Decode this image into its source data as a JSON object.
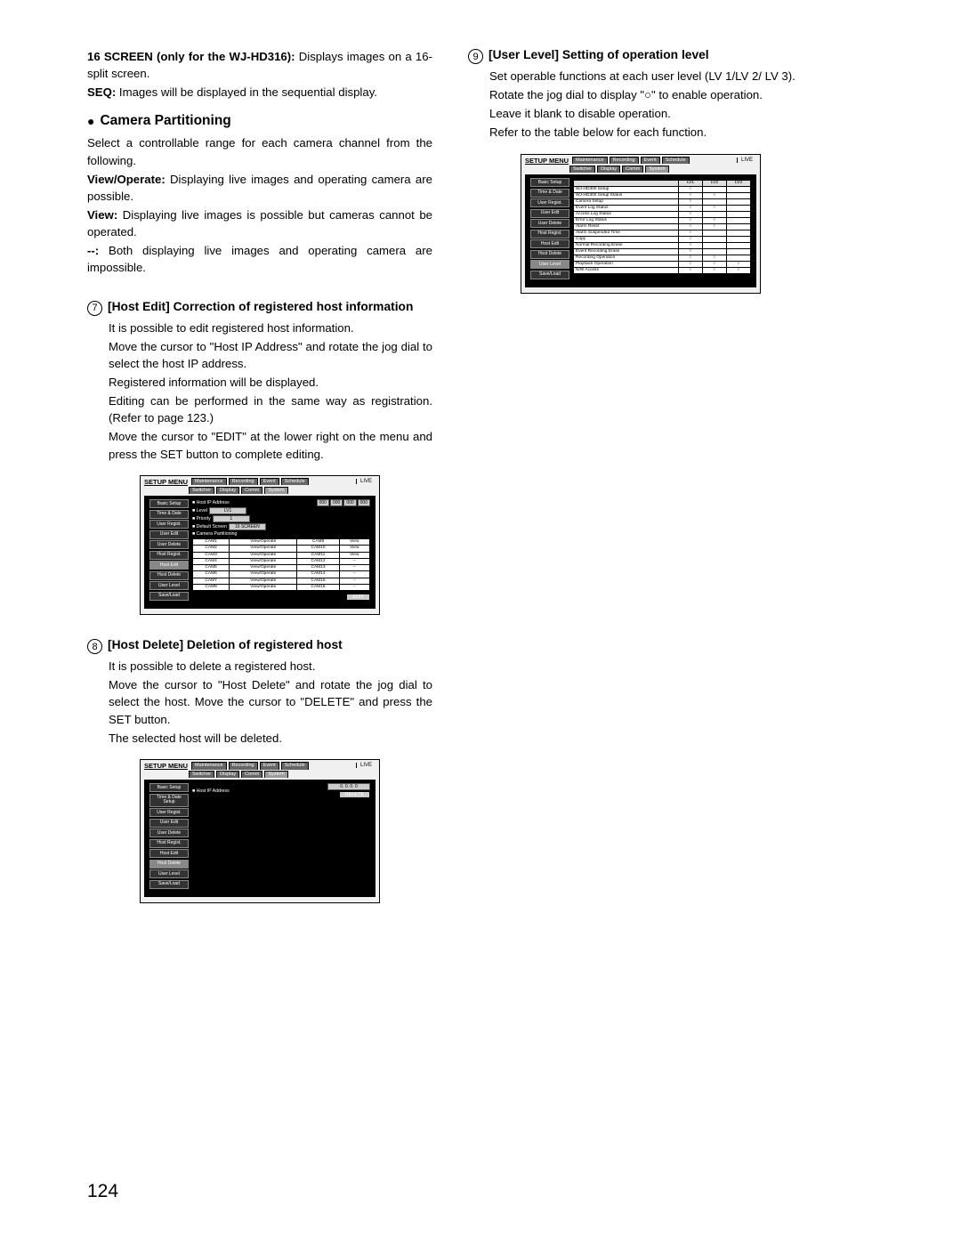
{
  "left": {
    "screen16": {
      "label": "16 SCREEN (only for the WJ-HD316):",
      "desc": "Displays images on a 16-split screen."
    },
    "seq": {
      "label": "SEQ:",
      "desc": "Images will be displayed in the sequential display."
    },
    "cam_part_title": "Camera Partitioning",
    "cam_part_intro": "Select a controllable range for each camera channel from the following.",
    "viewop": {
      "label": "View/Operate:",
      "desc": "Displaying live images and operating camera are possible."
    },
    "view": {
      "label": "View:",
      "desc": "Displaying live images is possible but cameras cannot be operated."
    },
    "dash": {
      "label": "--:",
      "desc": "Both displaying live images and operating camera are impossible."
    },
    "sec7": {
      "num": "7",
      "title": "[Host Edit] Correction of registered host information",
      "p1": "It is possible to edit registered host information.",
      "p2": "Move the cursor to \"Host IP Address\" and rotate the jog dial to select the host IP address.",
      "p3": "Registered information will be displayed.",
      "p4": "Editing can be performed in the same way as registration. (Refer to page 123.)",
      "p5": "Move the cursor to \"EDIT\" at the lower right on the menu and press the SET button to complete editing."
    },
    "fig7": {
      "title": "SETUP MENU",
      "tabs1": [
        "Maintenance",
        "Recording",
        "Event",
        "Schedule"
      ],
      "tabs2": [
        "Switcher",
        "Display",
        "Comm",
        "System"
      ],
      "live": "LIVE",
      "sidebar": [
        "Basic Setup",
        "Time & Date",
        "User Regist.",
        "User Edit",
        "User Delete",
        "Host Regist.",
        "Host Edit",
        "Host Delete",
        "User Level",
        "Save/Load"
      ],
      "sidebar_sel": "Host Edit",
      "fields": {
        "ip_label": "Host IP Address",
        "ip": [
          "000",
          "000",
          "000",
          "000"
        ],
        "level_label": "Level",
        "level": "LV1",
        "priority_label": "Priority",
        "priority": "1",
        "defscr_label": "Default Screen",
        "defscr": "16 SCREEN",
        "campart_label": "Camera Partitioning"
      },
      "cam_rows": [
        [
          "CAM1",
          "View/Operate",
          "CAM9",
          "View"
        ],
        [
          "CAM2",
          "View/Operate",
          "CAM10",
          "View"
        ],
        [
          "CAM3",
          "View/Operate",
          "CAM11",
          "View"
        ],
        [
          "CAM4",
          "View/Operate",
          "CAM12",
          "--"
        ],
        [
          "CAM5",
          "View/Operate",
          "CAM13",
          "--"
        ],
        [
          "CAM6",
          "View/Operate",
          "CAM14",
          "--"
        ],
        [
          "CAM7",
          "View/Operate",
          "CAM15",
          "--"
        ],
        [
          "CAM8",
          "View/Operate",
          "CAM16",
          "--"
        ]
      ],
      "edit": "EDIT"
    },
    "sec8": {
      "num": "8",
      "title": "[Host Delete] Deletion of registered host",
      "p1": "It is possible to delete a registered host.",
      "p2": "Move the cursor to \"Host Delete\" and rotate the jog dial to select the host. Move the cursor to \"DELETE\" and press the SET button.",
      "p3": "The selected host will be deleted."
    },
    "fig8": {
      "title": "SETUP MENU",
      "tabs1": [
        "Maintenance",
        "Recording",
        "Event",
        "Schedule"
      ],
      "tabs2": [
        "Switcher",
        "Display",
        "Comm",
        "System"
      ],
      "live": "LIVE",
      "sidebar": [
        "Basic Setup",
        "Time & Date Setup",
        "User Regist.",
        "User Edit",
        "User Delete",
        "Host Regist.",
        "Host Edit",
        "Host Delete",
        "User Level",
        "Save/Load"
      ],
      "sidebar_sel": "Host Delete",
      "ip_label": "Host IP Address",
      "ip": "0. 0. 0. 0",
      "delete": "DELETE"
    }
  },
  "right": {
    "sec9": {
      "num": "9",
      "title": "[User Level] Setting of operation level",
      "p1": "Set operable functions at each user level (LV 1/LV 2/ LV 3).",
      "p2": "Rotate the jog dial to display \"○\" to enable operation.",
      "p3": "Leave it blank to disable operation.",
      "p4": "Refer to the table below for each function."
    },
    "fig9": {
      "title": "SETUP MENU",
      "tabs1": [
        "Maintenance",
        "Recording",
        "Event",
        "Schedule"
      ],
      "tabs2": [
        "Switcher",
        "Display",
        "Comm",
        "System"
      ],
      "live": "LIVE",
      "sidebar": [
        "Basic Setup",
        "Time & Date",
        "User Regist.",
        "User Edit",
        "User Delete",
        "Host Regist.",
        "Host Edit",
        "Host Delete",
        "User Level",
        "Save/Load"
      ],
      "sidebar_sel": "User Level",
      "head": [
        "",
        "LV1",
        "LV2",
        "LV3"
      ],
      "rows": [
        [
          "WJ-HD300 Setup",
          "○",
          "",
          ""
        ],
        [
          "WJ-HD300 Setup Status",
          "○",
          "○",
          ""
        ],
        [
          "Camera Setup",
          "○",
          "",
          ""
        ],
        [
          "Event Log Status",
          "○",
          "○",
          ""
        ],
        [
          "Access Log Status",
          "○",
          "",
          ""
        ],
        [
          "Error Log Status",
          "○",
          "○",
          ""
        ],
        [
          "Alarm Reset",
          "○",
          "○",
          ""
        ],
        [
          "Alarm Suspended Time",
          "○",
          "",
          ""
        ],
        [
          "Copy",
          "○",
          "",
          ""
        ],
        [
          "Normal Recording Erase",
          "○",
          "",
          ""
        ],
        [
          "Event Recording Erase",
          "○",
          "",
          ""
        ],
        [
          "Recording Operation",
          "○",
          "○",
          ""
        ],
        [
          "Playback Operation",
          "○",
          "○",
          "○"
        ],
        [
          "N/W Access",
          "○",
          "○",
          "○"
        ]
      ]
    }
  },
  "page_number": "124"
}
